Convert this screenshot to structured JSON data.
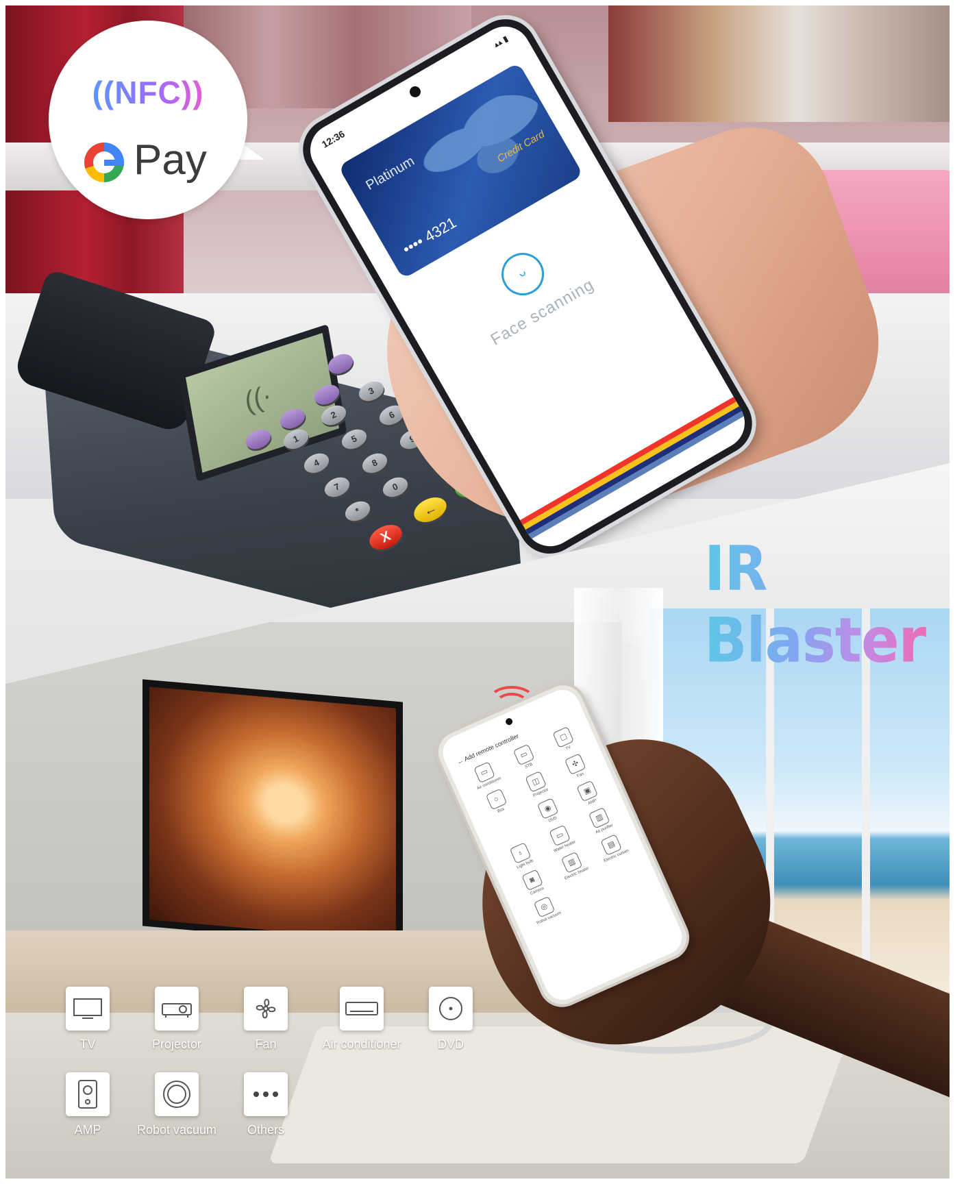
{
  "nfc_badge": {
    "nfc_label": "((NFC))",
    "pay_label": "Pay",
    "g_colors": [
      "#4285f4",
      "#34a853",
      "#fbbc05",
      "#ea4335"
    ]
  },
  "phone_payment": {
    "time": "12:36",
    "card_tier": "Platinum",
    "card_type": "Credit Card",
    "card_number": "•••• 4321",
    "face_icon": "face-scan-icon",
    "status_text": "Face scanning",
    "stripe_colors": [
      "#f0342a",
      "#f7c21b",
      "#1e2e7a",
      "#5b7fb8"
    ]
  },
  "pos_terminal": {
    "keys": [
      "1",
      "2",
      "3",
      "4",
      "5",
      "6",
      "7",
      "8",
      "9",
      "*",
      "0",
      "#"
    ],
    "cancel_key": "X",
    "enter_key": "←"
  },
  "ir_title": "IR Blaster",
  "phone_remote": {
    "title": "Add remote controller",
    "items": [
      {
        "label": "Air conditioner",
        "icon": "air-conditioner-icon",
        "glyph": "▭"
      },
      {
        "label": "STB",
        "icon": "stb-icon",
        "glyph": "▭"
      },
      {
        "label": "TV",
        "icon": "tv-icon",
        "glyph": "▢"
      },
      {
        "label": "Box",
        "icon": "box-icon",
        "glyph": "○"
      },
      {
        "label": "Projector",
        "icon": "projector-icon",
        "glyph": "◫"
      },
      {
        "label": "Fan",
        "icon": "fan-icon",
        "glyph": "✣"
      },
      {
        "label": "",
        "icon": "blank-icon",
        "glyph": ""
      },
      {
        "label": "DVD",
        "icon": "dvd-icon",
        "glyph": "◉"
      },
      {
        "label": "AMP",
        "icon": "amp-icon",
        "glyph": "▣"
      },
      {
        "label": "Light bulb",
        "icon": "light-bulb-icon",
        "glyph": "♁"
      },
      {
        "label": "Water heater",
        "icon": "water-heater-icon",
        "glyph": "▭"
      },
      {
        "label": "Air purifier",
        "icon": "air-purifier-icon",
        "glyph": "▥"
      },
      {
        "label": "Camera",
        "icon": "camera-icon",
        "glyph": "◙"
      },
      {
        "label": "Electric heater",
        "icon": "electric-heater-icon",
        "glyph": "▥"
      },
      {
        "label": "Electric curtain",
        "icon": "electric-curtain-icon",
        "glyph": "▤"
      },
      {
        "label": "Robot vacuum",
        "icon": "robot-vacuum-icon",
        "glyph": "◎"
      }
    ]
  },
  "devices": [
    {
      "label": "TV",
      "icon": "tv-icon"
    },
    {
      "label": "Projector",
      "icon": "projector-icon"
    },
    {
      "label": "Fan",
      "icon": "fan-icon"
    },
    {
      "label": "Air conditioner",
      "icon": "air-conditioner-icon"
    },
    {
      "label": "DVD",
      "icon": "dvd-icon"
    },
    {
      "label": "AMP",
      "icon": "amp-icon"
    },
    {
      "label": "Robot vacuum",
      "icon": "robot-vacuum-icon"
    },
    {
      "label": "Others",
      "icon": "others-icon"
    }
  ]
}
